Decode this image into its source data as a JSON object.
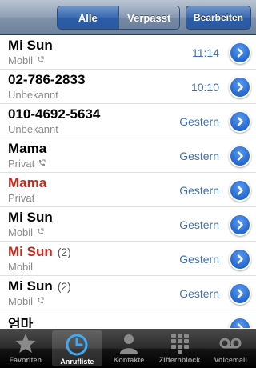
{
  "navbar": {
    "segments": [
      {
        "label": "Alle",
        "selected": true
      },
      {
        "label": "Verpasst",
        "selected": false
      }
    ],
    "edit_label": "Bearbeiten"
  },
  "calls": [
    {
      "name": "Mi Sun",
      "count": "",
      "missed": false,
      "type": "Mobil",
      "icon": true,
      "time": "11:14"
    },
    {
      "name": "02-786-2833",
      "count": "",
      "missed": false,
      "type": "Unbekannt",
      "icon": false,
      "time": "10:10"
    },
    {
      "name": "010-4692-5634",
      "count": "",
      "missed": false,
      "type": "Unbekannt",
      "icon": false,
      "time": "Gestern"
    },
    {
      "name": "Mama",
      "count": "",
      "missed": false,
      "type": "Privat",
      "icon": true,
      "time": "Gestern"
    },
    {
      "name": "Mama",
      "count": "",
      "missed": true,
      "type": "Privat",
      "icon": false,
      "time": "Gestern"
    },
    {
      "name": "Mi Sun",
      "count": "",
      "missed": false,
      "type": "Mobil",
      "icon": true,
      "time": "Gestern"
    },
    {
      "name": "Mi Sun",
      "count": "(2)",
      "missed": true,
      "type": "Mobil",
      "icon": false,
      "time": "Gestern"
    },
    {
      "name": "Mi Sun",
      "count": "(2)",
      "missed": false,
      "type": "Mobil",
      "icon": true,
      "time": "Gestern"
    },
    {
      "name": "엄마",
      "count": "",
      "missed": false,
      "type": "",
      "icon": false,
      "time": ""
    }
  ],
  "tabbar": {
    "tabs": [
      {
        "label": "Favoriten",
        "icon": "star-icon",
        "active": false
      },
      {
        "label": "Anrufliste",
        "icon": "clock-icon",
        "active": true
      },
      {
        "label": "Kontakte",
        "icon": "person-icon",
        "active": false
      },
      {
        "label": "Ziffernblock",
        "icon": "keypad-icon",
        "active": false
      },
      {
        "label": "Voicemail",
        "icon": "voicemail-icon",
        "active": false
      }
    ]
  },
  "colors": {
    "accent": "#2a6ed4",
    "missed": "#c8281e",
    "time": "#3f6fb5"
  }
}
